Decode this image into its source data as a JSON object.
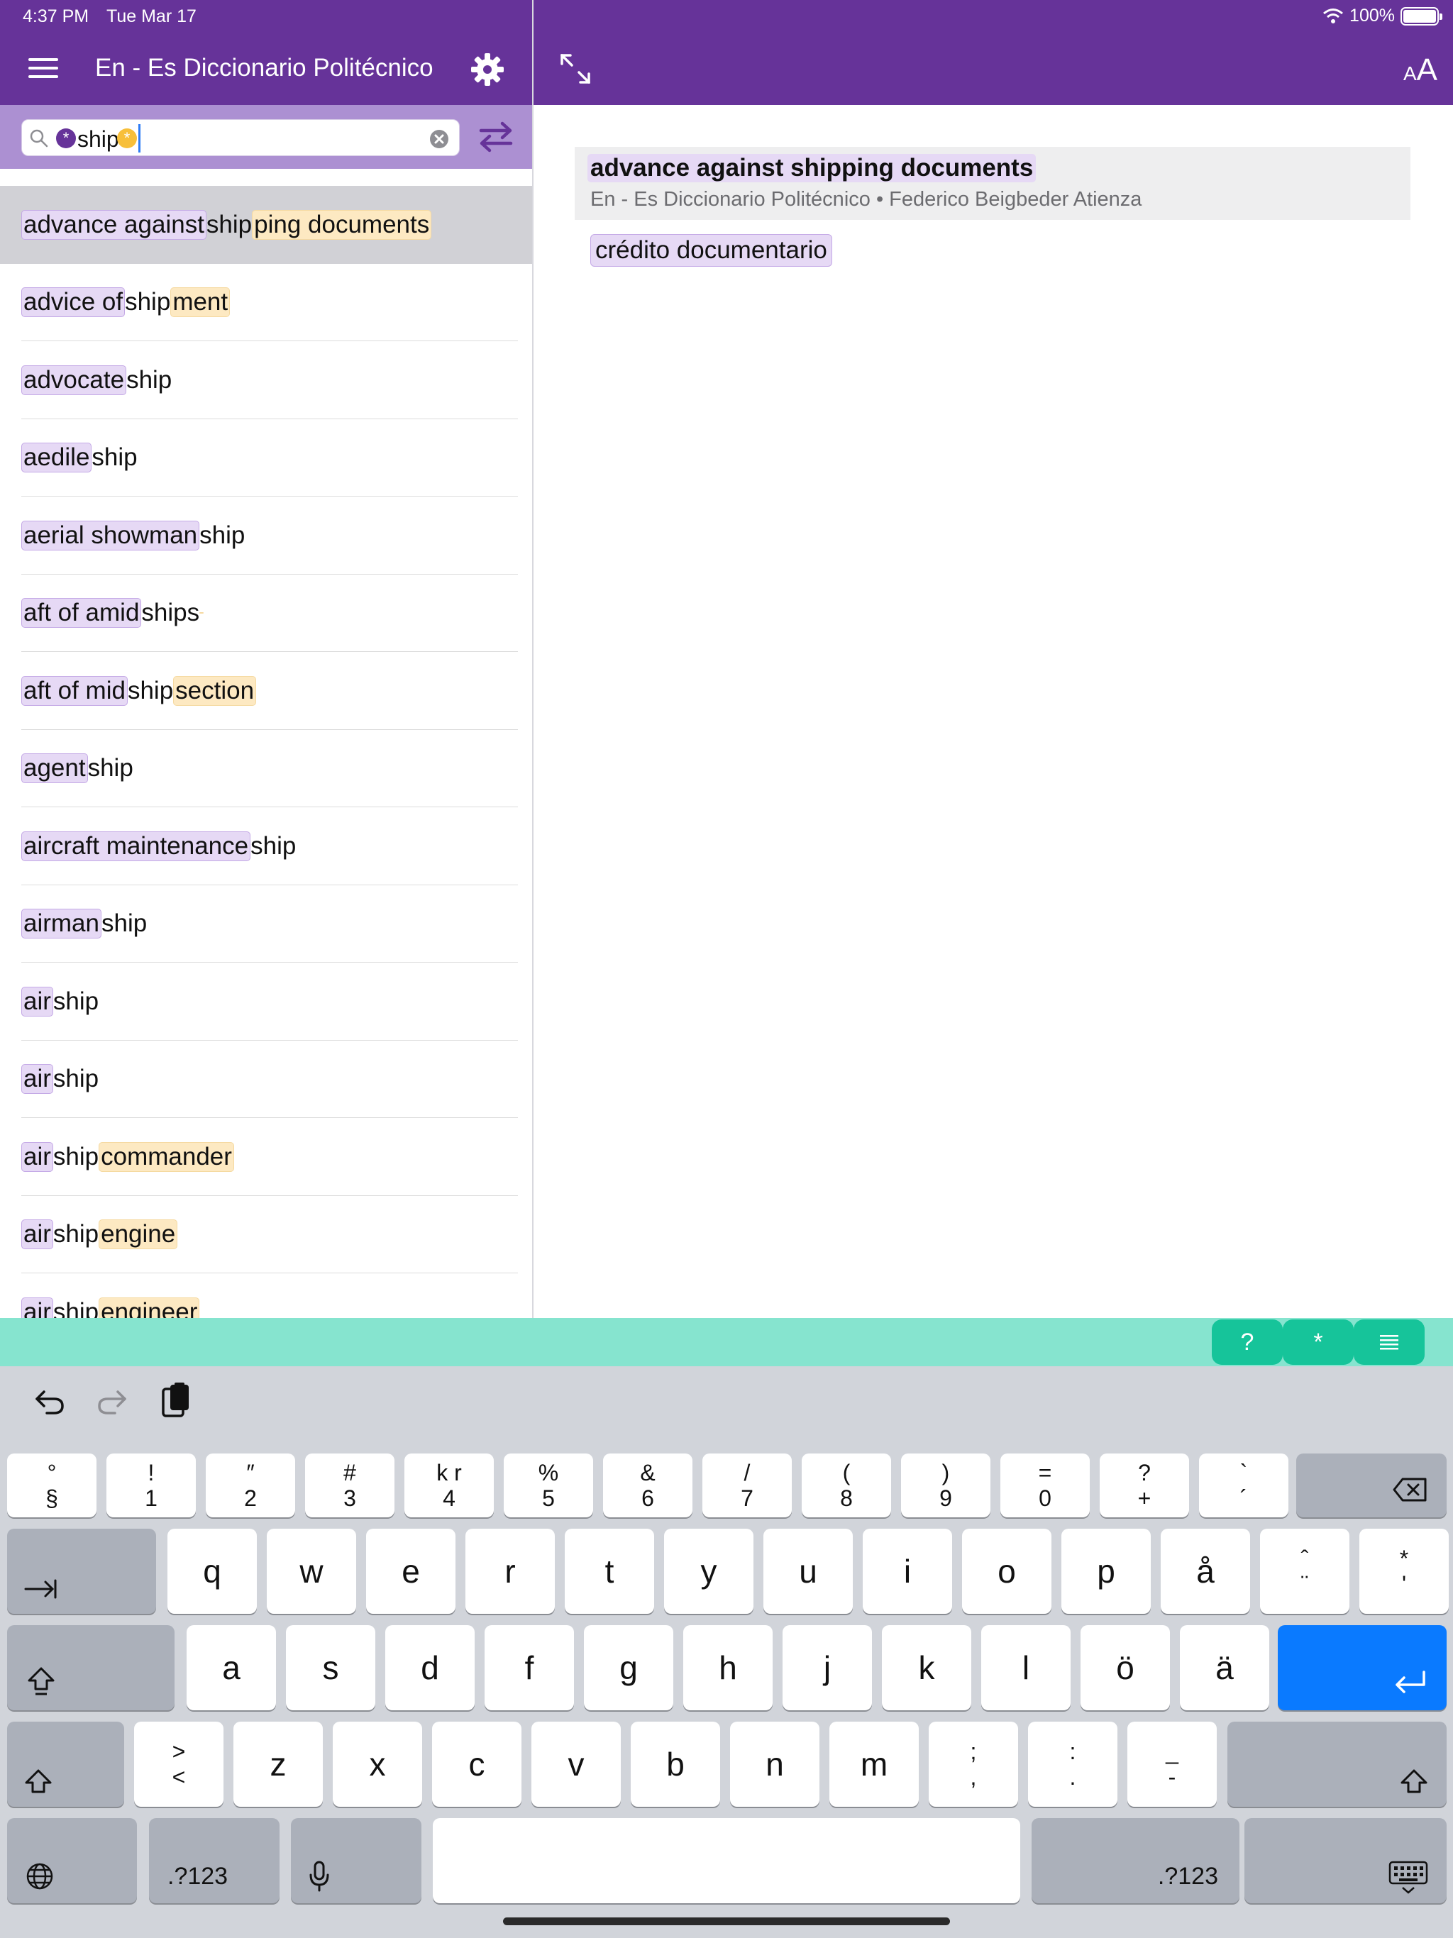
{
  "status": {
    "time": "4:37 PM",
    "date": "Tue Mar 17",
    "battery": "100%"
  },
  "header": {
    "title": "En - Es Diccionario Politécnico",
    "menu_icon": "hamburger-icon",
    "settings_icon": "gear-icon",
    "expand_icon": "expand-icon",
    "font_size_label": "AA"
  },
  "search": {
    "prefix_wildcard": "*",
    "query": "ship",
    "suffix_wildcard": "*",
    "swap_icon": "swap-arrows-icon"
  },
  "results": [
    [
      [
        "advance against ",
        "p"
      ],
      [
        "ship",
        ""
      ],
      [
        "ping documents",
        "y"
      ]
    ],
    [
      [
        "advice of ",
        "p"
      ],
      [
        "ship",
        ""
      ],
      [
        "ment",
        "y"
      ]
    ],
    [
      [
        "advocate",
        "p"
      ],
      [
        "ship",
        ""
      ]
    ],
    [
      [
        "aedile",
        "p"
      ],
      [
        "ship",
        ""
      ]
    ],
    [
      [
        "aerial showman",
        "p"
      ],
      [
        "ship",
        ""
      ]
    ],
    [
      [
        "aft of amid",
        "p"
      ],
      [
        "ships",
        ""
      ],
      [
        " ",
        "y"
      ]
    ],
    [
      [
        "aft of mid",
        "p"
      ],
      [
        "ship",
        ""
      ],
      [
        " section",
        "y"
      ]
    ],
    [
      [
        "agent",
        "p"
      ],
      [
        "ship",
        ""
      ]
    ],
    [
      [
        "aircraft maintenance ",
        "p"
      ],
      [
        "ship",
        ""
      ]
    ],
    [
      [
        "airman",
        "p"
      ],
      [
        "ship",
        ""
      ]
    ],
    [
      [
        "air ",
        "p"
      ],
      [
        "ship",
        ""
      ]
    ],
    [
      [
        "air",
        "p"
      ],
      [
        "ship",
        ""
      ]
    ],
    [
      [
        "air",
        "p"
      ],
      [
        "ship",
        ""
      ],
      [
        " commander",
        "y"
      ]
    ],
    [
      [
        "air",
        "p"
      ],
      [
        "ship",
        ""
      ],
      [
        " engine",
        "y"
      ]
    ],
    [
      [
        "air",
        "p"
      ],
      [
        "ship",
        ""
      ],
      [
        " engineer",
        "y"
      ]
    ]
  ],
  "detail": {
    "headword": "advance against shipping documents",
    "source": "En - Es Diccionario Politécnico • Federico Beigbeder Atienza",
    "translation": "crédito documentario"
  },
  "accessory": {
    "question": "?",
    "star": "*",
    "list_icon": "list-icon"
  },
  "keyboard": {
    "toolbar": [
      "undo-icon",
      "redo-icon",
      "clipboard-icon"
    ],
    "row1": [
      [
        "°",
        "§"
      ],
      [
        "!",
        "1"
      ],
      [
        "″",
        "2"
      ],
      [
        "#",
        "3"
      ],
      [
        "k r",
        "4"
      ],
      [
        "%",
        "5"
      ],
      [
        "&",
        "6"
      ],
      [
        "/",
        "7"
      ],
      [
        "(",
        "8"
      ],
      [
        ")",
        "9"
      ],
      [
        "=",
        "0"
      ],
      [
        "?",
        "+"
      ],
      [
        "`",
        "´"
      ]
    ],
    "row2": [
      "q",
      "w",
      "e",
      "r",
      "t",
      "y",
      "u",
      "i",
      "o",
      "p",
      "å",
      [
        "ˆ",
        "¨"
      ],
      [
        "*",
        "'"
      ]
    ],
    "row3": [
      "a",
      "s",
      "d",
      "f",
      "g",
      "h",
      "j",
      "k",
      "l",
      "ö",
      "ä"
    ],
    "row4": [
      [
        ">",
        "<"
      ],
      "z",
      "x",
      "c",
      "v",
      "b",
      "n",
      "m",
      [
        ";",
        ","
      ],
      [
        ":",
        "."
      ],
      [
        "_",
        "-"
      ]
    ],
    "numbers_label": ".?123",
    "tab_label": "⇥",
    "icons": [
      "delete-icon",
      "tab-icon",
      "caps-lock-icon",
      "return-icon",
      "shift-icon",
      "globe-icon",
      "microphone-icon",
      "keyboard-dismiss-icon"
    ]
  },
  "colors": {
    "header": "#663399",
    "search_bar": "#ac90d2",
    "match_purple": "#e6d9f5",
    "match_yellow": "#fde9c2",
    "accessory": "#86e4cf",
    "accessory_button": "#16c49a",
    "return_key": "#0a7aff"
  }
}
